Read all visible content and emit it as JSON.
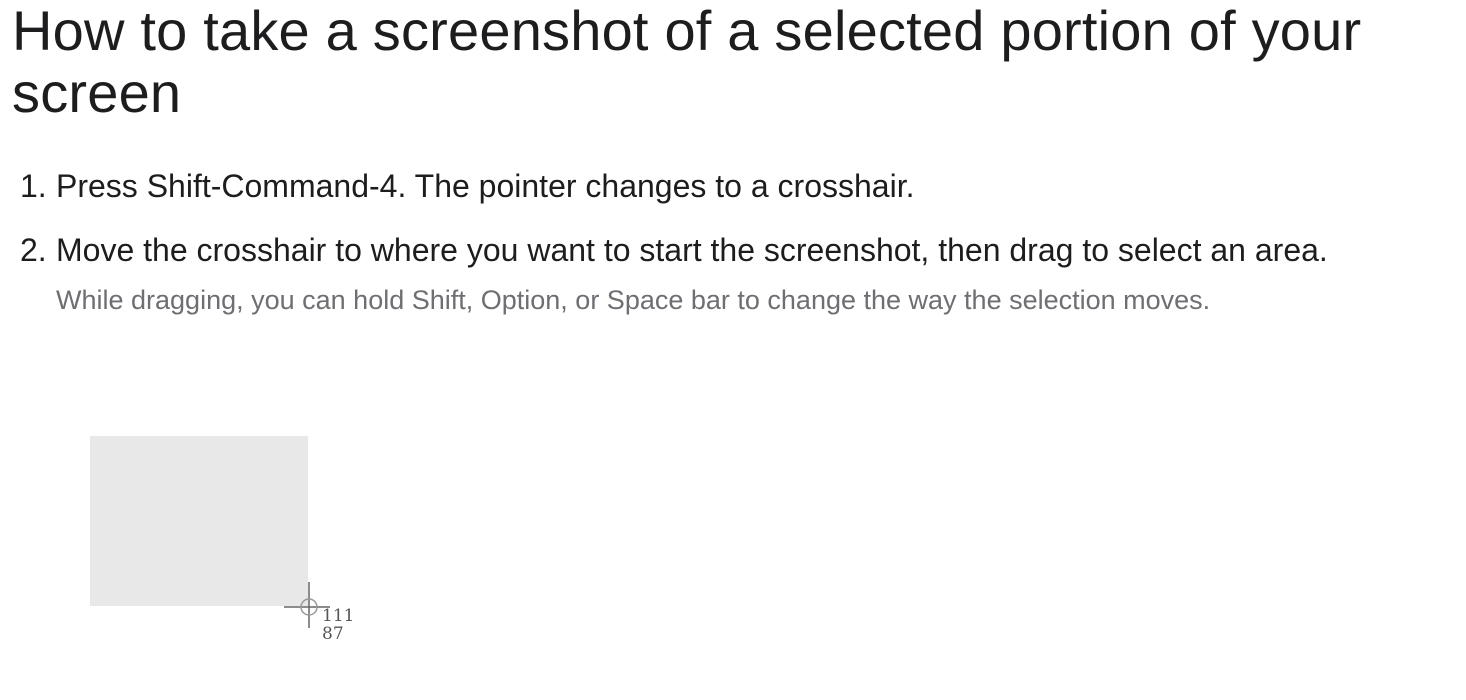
{
  "title": "How to take a screenshot of a selected portion of your screen",
  "steps": [
    {
      "number": "1.",
      "text": "Press Shift-Command-4. The pointer changes to a crosshair."
    },
    {
      "number": "2.",
      "text": "Move the crosshair to where you want to start the screenshot, then drag to select an area.",
      "note": "While dragging, you can hold Shift, Option, or Space bar to change the way the selection moves."
    }
  ],
  "illustration": {
    "icon": "crosshair-icon",
    "selection_color": "#e8e8e8",
    "readout_width": "111",
    "readout_height": "87"
  }
}
